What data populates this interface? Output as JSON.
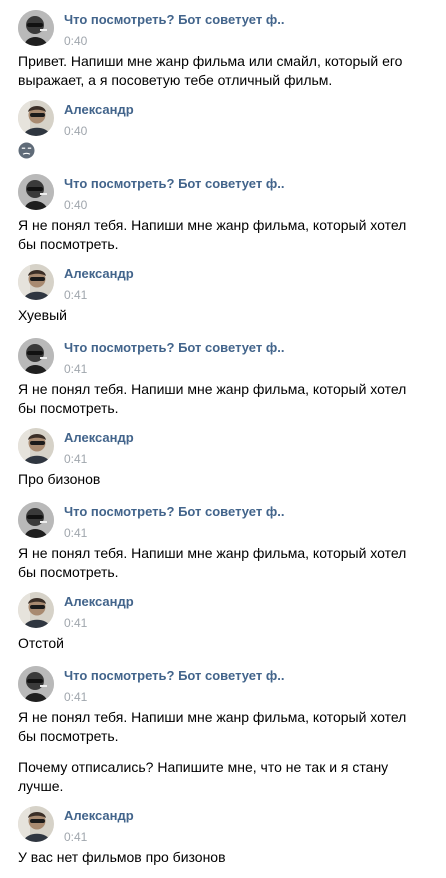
{
  "senders": {
    "bot": "Что посмотреть? Бот советует ф..",
    "user": "Александр"
  },
  "messages": [
    {
      "time": "0:40",
      "text": "Привет. Напиши мне жанр фильма или смайл, который его\nвыражает, а я посоветую тебе отличный фильм."
    },
    {
      "time": "0:40",
      "emoji": "unamused-emoji-icon"
    },
    {
      "time": "0:40",
      "text": "Я не понял тебя. Напиши мне жанр фильма, который хотел\nбы посмотреть."
    },
    {
      "time": "0:41",
      "text": "Хуевый"
    },
    {
      "time": "0:41",
      "text": "Я не понял тебя. Напиши мне жанр фильма, который хотел\nбы посмотреть."
    },
    {
      "time": "0:41",
      "text": "Про бизонов"
    },
    {
      "time": "0:41",
      "text": "Я не понял тебя. Напиши мне жанр фильма, который хотел\nбы посмотреть."
    },
    {
      "time": "0:41",
      "text": "Отстой"
    },
    {
      "time": "0:41",
      "text": "Я не понял тебя. Напиши мне жанр фильма, который хотел\nбы посмотреть.",
      "text2": "Почему отписались? Напишите мне, что не так и я стану\nлучше."
    },
    {
      "time": "0:41",
      "text": "У вас нет фильмов про бизонов"
    }
  ],
  "colors": {
    "author": "#42648b",
    "time": "#a0a6ad",
    "text": "#000000",
    "background": "#ffffff"
  }
}
